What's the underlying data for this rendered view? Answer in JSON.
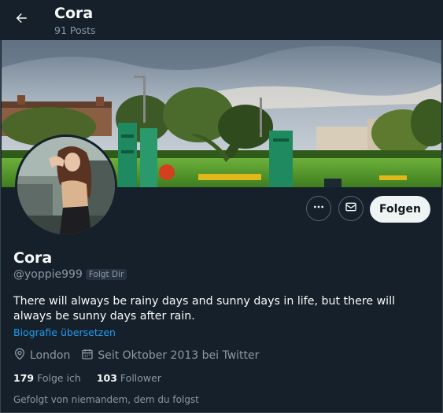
{
  "header": {
    "title": "Cora",
    "posts_count": "91 Posts"
  },
  "profile": {
    "name": "Cora",
    "handle": "@yoppie999",
    "follows_you_badge": "Folgt Dir",
    "bio": "There will always be rainy days and sunny days in life, but there will always be sunny days after rain.",
    "translate_bio": "Biografie übersetzen",
    "location": "London",
    "joined": "Seit Oktober 2013 bei Twitter",
    "following_count": "179",
    "following_label": "Folge ich",
    "followers_count": "103",
    "followers_label": "Follower",
    "followed_by": "Gefolgt von niemandem, dem du folgst"
  },
  "actions": {
    "follow_label": "Folgen"
  },
  "icons": {
    "back": "arrow-left-icon",
    "more": "more-icon",
    "message": "mail-icon",
    "location": "location-pin-icon",
    "calendar": "calendar-icon"
  },
  "colors": {
    "background": "#15202b",
    "accent": "#1d9bf0",
    "secondary_text": "#8b98a5"
  }
}
